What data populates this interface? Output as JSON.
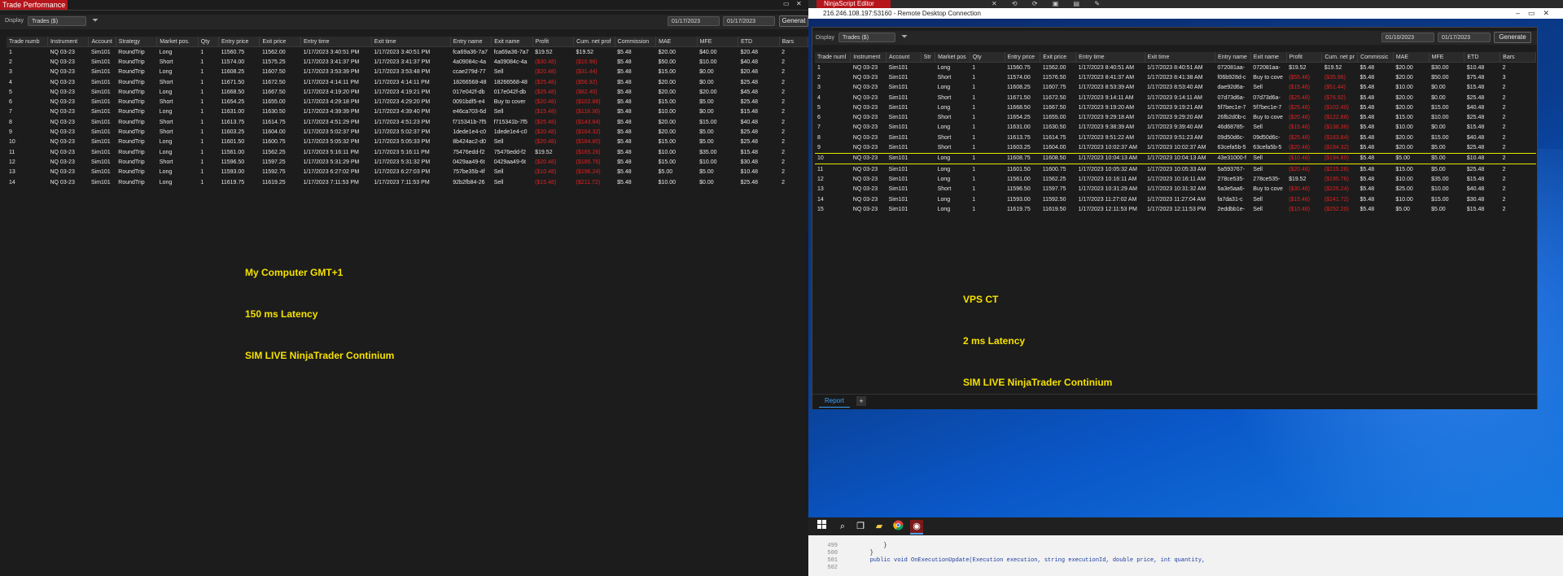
{
  "left_app": {
    "title": "Trade Performance",
    "display_label": "Display",
    "display_value": "Trades ($)",
    "date_from": "01/17/2023",
    "date_to": "01/17/2023",
    "generate_label": "Generat",
    "columns": [
      "Trade numb",
      "Instrument",
      "Account",
      "Strategy",
      "Market pos.",
      "Qty",
      "Entry price",
      "Exit price",
      "Entry time",
      "Exit time",
      "Entry name",
      "Exit name",
      "Profit",
      "Cum. net prof",
      "Commission",
      "MAE",
      "MFE",
      "ETD",
      "Bars"
    ],
    "rows": [
      [
        "1",
        "NQ 03-23",
        "Sim101",
        "RoundTrip",
        "Long",
        "1",
        "11560.75",
        "11562.00",
        "1/17/2023 3:40:51 PM",
        "1/17/2023 3:40:51 PM",
        "fca69a36-7a7",
        "fca69a36-7a7",
        "$19.52",
        "$19.52",
        "$5.48",
        "$20.00",
        "$40.00",
        "$20.48",
        "2"
      ],
      [
        "2",
        "NQ 03-23",
        "Sim101",
        "RoundTrip",
        "Short",
        "1",
        "11574.00",
        "11575.25",
        "1/17/2023 3:41:37 PM",
        "1/17/2023 3:41:37 PM",
        "4a09084c-4a",
        "4a09084c-4a",
        "($30.48)",
        "($10.96)",
        "$5.48",
        "$50.00",
        "$10.00",
        "$40.48",
        "2"
      ],
      [
        "3",
        "NQ 03-23",
        "Sim101",
        "RoundTrip",
        "Long",
        "1",
        "11608.25",
        "11607.50",
        "1/17/2023 3:53:39 PM",
        "1/17/2023 3:53:48 PM",
        "ccae279d-77",
        "Sell",
        "($20.48)",
        "($31.44)",
        "$5.48",
        "$15.00",
        "$0.00",
        "$20.48",
        "2"
      ],
      [
        "4",
        "NQ 03-23",
        "Sim101",
        "RoundTrip",
        "Short",
        "1",
        "11671.50",
        "11672.50",
        "1/17/2023 4:14:11 PM",
        "1/17/2023 4:14:11 PM",
        "18266568-48",
        "18266568-48",
        "($25.48)",
        "($56.92)",
        "$5.48",
        "$20.00",
        "$0.00",
        "$25.48",
        "2"
      ],
      [
        "5",
        "NQ 03-23",
        "Sim101",
        "RoundTrip",
        "Long",
        "1",
        "11668.50",
        "11667.50",
        "1/17/2023 4:19:20 PM",
        "1/17/2023 4:19:21 PM",
        "017e042f-db",
        "017e042f-db",
        "($25.48)",
        "($82.40)",
        "$5.48",
        "$20.00",
        "$20.00",
        "$45.48",
        "2"
      ],
      [
        "6",
        "NQ 03-23",
        "Sim101",
        "RoundTrip",
        "Short",
        "1",
        "11654.25",
        "11655.00",
        "1/17/2023 4:29:18 PM",
        "1/17/2023 4:29:20 PM",
        "0091bdf5-e4",
        "Buy to cover",
        "($20.48)",
        "($102.88)",
        "$5.48",
        "$15.00",
        "$5.00",
        "$25.48",
        "2"
      ],
      [
        "7",
        "NQ 03-23",
        "Sim101",
        "RoundTrip",
        "Long",
        "1",
        "11631.00",
        "11630.50",
        "1/17/2023 4:39:39 PM",
        "1/17/2023 4:39:40 PM",
        "e46ca703-6d",
        "Sell",
        "($15.48)",
        "($118.36)",
        "$5.48",
        "$10.00",
        "$0.00",
        "$15.48",
        "2"
      ],
      [
        "8",
        "NQ 03-23",
        "Sim101",
        "RoundTrip",
        "Short",
        "1",
        "11613.75",
        "11614.75",
        "1/17/2023 4:51:29 PM",
        "1/17/2023 4:51:23 PM",
        "f715341b-7f5",
        "f715341b-7f5",
        "($25.48)",
        "($143.84)",
        "$5.48",
        "$20.00",
        "$15.00",
        "$40.48",
        "2"
      ],
      [
        "9",
        "NQ 03-23",
        "Sim101",
        "RoundTrip",
        "Short",
        "1",
        "11603.25",
        "11604.00",
        "1/17/2023 5:02:37 PM",
        "1/17/2023 5:02:37 PM",
        "1dede1e4-c0",
        "1dede1e4-c0",
        "($20.48)",
        "($164.32)",
        "$5.48",
        "$20.00",
        "$5.00",
        "$25.48",
        "2"
      ],
      [
        "10",
        "NQ 03-23",
        "Sim101",
        "RoundTrip",
        "Long",
        "1",
        "11601.50",
        "11600.75",
        "1/17/2023 5:05:32 PM",
        "1/17/2023 5:05:33 PM",
        "8b424ac2-d0",
        "Sell",
        "($20.48)",
        "($184.80)",
        "$5.48",
        "$15.00",
        "$5.00",
        "$25.48",
        "2"
      ],
      [
        "11",
        "NQ 03-23",
        "Sim101",
        "RoundTrip",
        "Long",
        "1",
        "11561.00",
        "11562.25",
        "1/17/2023 5:16:11 PM",
        "1/17/2023 5:16:11 PM",
        "75476edd-f2",
        "75476edd-f2",
        "$19.52",
        "($165.28)",
        "$5.48",
        "$10.00",
        "$35.00",
        "$15.48",
        "2"
      ],
      [
        "12",
        "NQ 03-23",
        "Sim101",
        "RoundTrip",
        "Short",
        "1",
        "11596.50",
        "11597.25",
        "1/17/2023 5:31:29 PM",
        "1/17/2023 5:31:32 PM",
        "0429aa49-6t",
        "0429aa49-6t",
        "($20.48)",
        "($185.76)",
        "$5.48",
        "$15.00",
        "$10.00",
        "$30.48",
        "2"
      ],
      [
        "13",
        "NQ 03-23",
        "Sim101",
        "RoundTrip",
        "Long",
        "1",
        "11593.00",
        "11592.75",
        "1/17/2023 6:27:02 PM",
        "1/17/2023 6:27:03 PM",
        "757be35b-4f",
        "Sell",
        "($10.48)",
        "($196.24)",
        "$5.48",
        "$5.00",
        "$5.00",
        "$10.48",
        "2"
      ],
      [
        "14",
        "NQ 03-23",
        "Sim101",
        "RoundTrip",
        "Long",
        "1",
        "11619.75",
        "11619.25",
        "1/17/2023 7:11:53 PM",
        "1/17/2023 7:11:53 PM",
        "92b2fb84-26",
        "Sell",
        "($15.48)",
        "($211.72)",
        "$5.48",
        "$10.00",
        "$0.00",
        "$25.48",
        "2"
      ]
    ],
    "note_lines": [
      "My Computer GMT+1",
      "150 ms Latency",
      "SIM LIVE NinjaTrader Continium"
    ]
  },
  "rdp": {
    "ninjascript_title": "NinjaScript Editor",
    "title": "216.246.108.197:53160 - Remote Desktop Connection",
    "display_label": "Display",
    "display_value": "Trades ($)",
    "date_from": "01/10/2023",
    "date_to": "01/17/2023",
    "generate_label": "Generate",
    "report_tab": "Report",
    "add_tab": "+",
    "highlight_row": 9,
    "columns": [
      "Trade numl",
      "Instrument",
      "Account",
      "Str",
      "Market pos",
      "Qty",
      "Entry price",
      "Exit price",
      "Entry time",
      "Exit time",
      "Entry name",
      "Exit name",
      "Profit",
      "Cum. net pr",
      "Commissic",
      "MAE",
      "MFE",
      "ETD",
      "Bars"
    ],
    "rows": [
      [
        "1",
        "NQ 03-23",
        "Sim101",
        "",
        "Long",
        "1",
        "11560.75",
        "11562.00",
        "1/17/2023 8:40:51 AM",
        "1/17/2023 8:40:51 AM",
        "072081aa-",
        "072081aa-",
        "$19.52",
        "$19.52",
        "$5.48",
        "$20.00",
        "$30.00",
        "$10.48",
        "2"
      ],
      [
        "2",
        "NQ 03-23",
        "Sim101",
        "",
        "Short",
        "1",
        "11574.00",
        "11576.50",
        "1/17/2023 8:41:37 AM",
        "1/17/2023 8:41:38 AM",
        "f06b928d-c",
        "Buy to cove",
        "($55.48)",
        "($35.96)",
        "$5.48",
        "$20.00",
        "$50.00",
        "$75.48",
        "3"
      ],
      [
        "3",
        "NQ 03-23",
        "Sim101",
        "",
        "Long",
        "1",
        "11608.25",
        "11607.75",
        "1/17/2023 8:53:39 AM",
        "1/17/2023 8:53:40 AM",
        "dae92d6a-",
        "Sell",
        "($15.48)",
        "($51.44)",
        "$5.48",
        "$10.00",
        "$0.00",
        "$15.48",
        "2"
      ],
      [
        "4",
        "NQ 03-23",
        "Sim101",
        "",
        "Short",
        "1",
        "11671.50",
        "11672.50",
        "1/17/2023 9:14:11 AM",
        "1/17/2023 9:14:11 AM",
        "07d73d6a-",
        "07d73d6a-",
        "($25.48)",
        "($76.92)",
        "$5.48",
        "$20.00",
        "$0.00",
        "$25.48",
        "2"
      ],
      [
        "5",
        "NQ 03-23",
        "Sim101",
        "",
        "Long",
        "1",
        "11668.50",
        "11667.50",
        "1/17/2023 9:19:20 AM",
        "1/17/2023 9:19:21 AM",
        "5f7bec1e-7",
        "5f7bec1e-7",
        "($25.48)",
        "($102.40)",
        "$5.48",
        "$20.00",
        "$15.00",
        "$40.48",
        "2"
      ],
      [
        "6",
        "NQ 03-23",
        "Sim101",
        "",
        "Short",
        "1",
        "11654.25",
        "11655.00",
        "1/17/2023 9:29:18 AM",
        "1/17/2023 9:29:20 AM",
        "26fb2d0b-c",
        "Buy to cove",
        "($20.48)",
        "($122.88)",
        "$5.48",
        "$15.00",
        "$10.00",
        "$25.48",
        "2"
      ],
      [
        "7",
        "NQ 03-23",
        "Sim101",
        "",
        "Long",
        "1",
        "11631.00",
        "11630.50",
        "1/17/2023 9:38:39 AM",
        "1/17/2023 9:39:40 AM",
        "46d68785-",
        "Sell",
        "($15.48)",
        "($138.36)",
        "$5.48",
        "$10.00",
        "$0.00",
        "$15.48",
        "2"
      ],
      [
        "8",
        "NQ 03-23",
        "Sim101",
        "",
        "Short",
        "1",
        "11613.75",
        "11614.75",
        "1/17/2023 9:51:22 AM",
        "1/17/2023 9:51:23 AM",
        "09d50d6c-",
        "09d50d6c-",
        "($25.48)",
        "($163.84)",
        "$5.48",
        "$20.00",
        "$15.00",
        "$40.48",
        "2"
      ],
      [
        "9",
        "NQ 03-23",
        "Sim101",
        "",
        "Short",
        "1",
        "11603.25",
        "11604.00",
        "1/17/2023 10:02:37 AM",
        "1/17/2023 10:02:37 AM",
        "63cefa5b-5",
        "63cefa5b-5",
        "($20.48)",
        "($184.32)",
        "$5.48",
        "$20.00",
        "$5.00",
        "$25.48",
        "2"
      ],
      [
        "10",
        "NQ 03-23",
        "Sim101",
        "",
        "Long",
        "1",
        "11608.75",
        "11608.50",
        "1/17/2023 10:04:13 AM",
        "1/17/2023 10:04:13 AM",
        "43e31000-f",
        "Sell",
        "($10.48)",
        "($194.80)",
        "$5.48",
        "$5.00",
        "$5.00",
        "$10.48",
        "2"
      ],
      [
        "11",
        "NQ 03-23",
        "Sim101",
        "",
        "Long",
        "1",
        "11601.50",
        "11600.75",
        "1/17/2023 10:05:32 AM",
        "1/17/2023 10:05:33 AM",
        "5a593767-",
        "Sell",
        "($20.48)",
        "($215.28)",
        "$5.48",
        "$15.00",
        "$5.00",
        "$25.48",
        "2"
      ],
      [
        "12",
        "NQ 03-23",
        "Sim101",
        "",
        "Long",
        "1",
        "11561.00",
        "11562.25",
        "1/17/2023 10:16:11 AM",
        "1/17/2023 10:16:11 AM",
        "278ce535-",
        "278ce535-",
        "$19.52",
        "($195.76)",
        "$5.48",
        "$10.00",
        "$35.00",
        "$15.48",
        "2"
      ],
      [
        "13",
        "NQ 03-23",
        "Sim101",
        "",
        "Short",
        "1",
        "11596.50",
        "11597.75",
        "1/17/2023 10:31:29 AM",
        "1/17/2023 10:31:32 AM",
        "5a3e5aa6-",
        "Buy to cove",
        "($30.48)",
        "($226.24)",
        "$5.48",
        "$25.00",
        "$10.00",
        "$40.48",
        "2"
      ],
      [
        "14",
        "NQ 03-23",
        "Sim101",
        "",
        "Long",
        "1",
        "11593.00",
        "11592.50",
        "1/17/2023 11:27:02 AM",
        "1/17/2023 11:27:04 AM",
        "fa7da31-c",
        "Sell",
        "($15.48)",
        "($241.72)",
        "$5.48",
        "$10.00",
        "$15.00",
        "$30.48",
        "2"
      ],
      [
        "15",
        "NQ 03-23",
        "Sim101",
        "",
        "Long",
        "1",
        "11619.75",
        "11619.50",
        "1/17/2023 12:11:53 PM",
        "1/17/2023 12:11:53 PM",
        "2eddbb1e-",
        "Sell",
        "($10.48)",
        "($252.20)",
        "$5.48",
        "$5.00",
        "$5.00",
        "$15.48",
        "2"
      ]
    ],
    "note_lines": [
      "VPS CT",
      "2 ms Latency",
      "SIM LIVE NinjaTrader Continium"
    ]
  },
  "editor": {
    "lines": [
      {
        "num": "499",
        "code": "            }"
      },
      {
        "num": "500",
        "code": "        }"
      },
      {
        "num": "501",
        "code": "        public void OnExecutionUpdate(Execution execution, string executionId, double price, int quantity,"
      },
      {
        "num": "502",
        "code": ""
      }
    ]
  },
  "colors": {
    "negative": "#e02020",
    "highlight": "#e8e800",
    "note": "#f5e100",
    "title_red": "#b5151b"
  }
}
